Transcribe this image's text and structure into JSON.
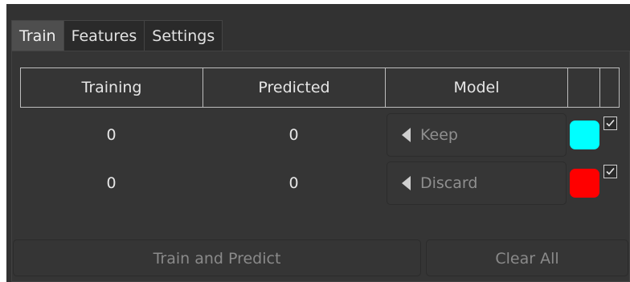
{
  "tabs": [
    {
      "label": "Train",
      "active": true
    },
    {
      "label": "Features",
      "active": false
    },
    {
      "label": "Settings",
      "active": false
    }
  ],
  "table": {
    "headers": {
      "training": "Training",
      "predicted": "Predicted",
      "model": "Model"
    },
    "rows": [
      {
        "training": "0",
        "predicted": "0",
        "model": "Keep",
        "color": "#00ffff",
        "checked": true,
        "model_icon": "play-left-icon"
      },
      {
        "training": "0",
        "predicted": "0",
        "model": "Discard",
        "color": "#ff0000",
        "checked": true,
        "model_icon": "play-left-icon"
      }
    ]
  },
  "buttons": {
    "train_and_predict": "Train and Predict",
    "clear_all": "Clear All"
  },
  "colors": {
    "background": "#323232",
    "accent_keep": "#00ffff",
    "accent_discard": "#ff0000"
  }
}
